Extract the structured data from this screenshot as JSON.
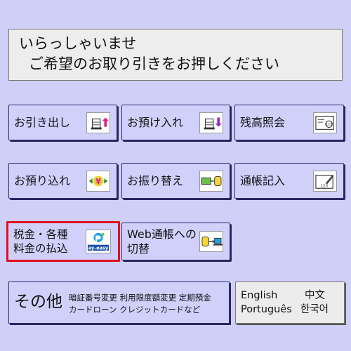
{
  "banner": {
    "line1": "いらっしゃいませ",
    "line2": "ご希望のお取り引きをお押しください"
  },
  "buttons": {
    "withdraw": {
      "label": "お引き出し",
      "icon": "cash-out-icon"
    },
    "deposit": {
      "label": "お預け入れ",
      "icon": "cash-in-icon"
    },
    "balance": {
      "label": "残高照会",
      "icon": "balance-inquiry-icon"
    },
    "deposit_transfer": {
      "label": "お預り込れ",
      "icon": "yen-transfer-icon"
    },
    "account_transfer": {
      "label": "お振り替え",
      "icon": "account-transfer-icon"
    },
    "passbook": {
      "label": "通帳記入",
      "icon": "passbook-entry-icon"
    },
    "tax_payment": {
      "label_line1": "税金・各種",
      "label_line2": "料金の払込",
      "icon": "pay-easy-logo",
      "logo_text": "ay-easy"
    },
    "web_switch": {
      "label_line1": "Web通帳への",
      "label_line2": "切替",
      "icon": "web-switch-icon"
    }
  },
  "other": {
    "label": "その他",
    "sub1": "暗証番号変更 利用限度額変更 定期預金",
    "sub2": "カードローン クレジットカードなど"
  },
  "language": {
    "english": "English",
    "chinese": "中文",
    "portuguese": "Português",
    "korean": "한국어"
  },
  "colors": {
    "background": "#cfcff7",
    "button": "#d0d0fb",
    "highlight": "#e0101e"
  }
}
